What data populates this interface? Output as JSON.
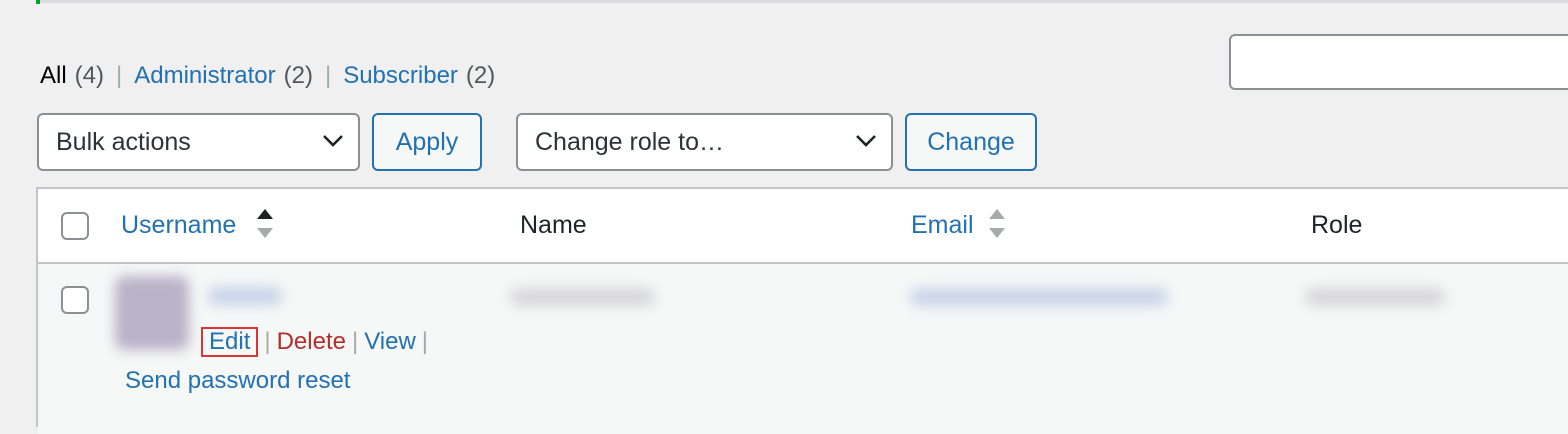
{
  "filters": {
    "all_label": "All",
    "all_count": "(4)",
    "administrator_label": "Administrator",
    "administrator_count": "(2)",
    "subscriber_label": "Subscriber",
    "subscriber_count": "(2)",
    "separator": "|"
  },
  "search": {
    "placeholder": ""
  },
  "bulk": {
    "selected": "Bulk actions",
    "apply_label": "Apply"
  },
  "role_change": {
    "selected": "Change role to…",
    "change_label": "Change"
  },
  "table": {
    "columns": {
      "username": "Username",
      "name": "Name",
      "email": "Email",
      "role": "Role"
    }
  },
  "row_actions": {
    "edit": "Edit",
    "delete": "Delete",
    "view": "View",
    "separator": "|",
    "send_password_reset": "Send password reset"
  },
  "colors": {
    "link": "#2271b1",
    "delete": "#b32d2e",
    "highlight_border": "#d63638",
    "notice_accent": "#00a32a"
  },
  "icons": {
    "dropdown": "chevron-down-icon",
    "sort_asc": "sort-ascending-icon",
    "sort_none": "sort-icon"
  }
}
